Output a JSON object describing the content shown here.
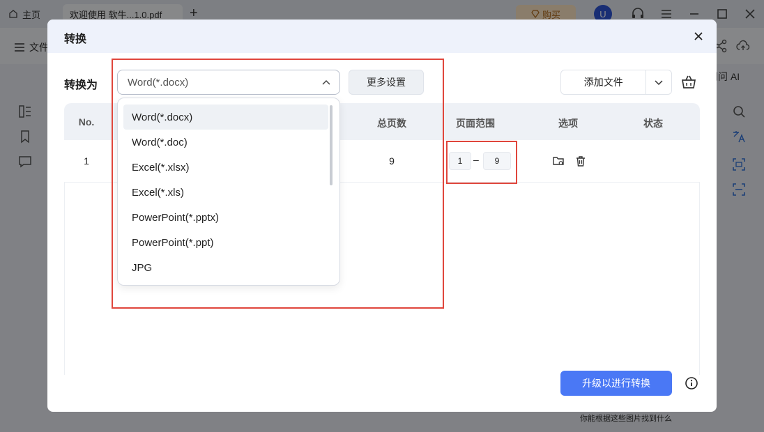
{
  "app": {
    "home_tab": "主页",
    "doc_tab": "欢迎使用 软牛...1.0.pdf",
    "buy_label": "购买",
    "avatar_letter": "U",
    "file_menu": "文件",
    "ask_ai": "问问 AI",
    "bottom_hint": "你能根据这些图片找到什么"
  },
  "dialog": {
    "title": "转换",
    "convert_to_label": "转换为",
    "selected_format": "Word(*.docx)",
    "more_settings": "更多设置",
    "add_file": "添加文件",
    "table": {
      "headers": [
        "No.",
        "总页数",
        "页面范围",
        "选项",
        "状态"
      ],
      "rows": [
        {
          "no": "1",
          "total_pages": "9",
          "range_from": "1",
          "range_dash": "–",
          "range_to": "9",
          "status": ""
        }
      ]
    },
    "upgrade_button": "升级以进行转换",
    "format_options": [
      "Word(*.docx)",
      "Word(*.doc)",
      "Excel(*.xlsx)",
      "Excel(*.xls)",
      "PowerPoint(*.pptx)",
      "PowerPoint(*.ppt)",
      "JPG"
    ]
  },
  "colors": {
    "primary": "#4a78f5",
    "highlight": "#e0463c",
    "avatar": "#2f55d4"
  }
}
